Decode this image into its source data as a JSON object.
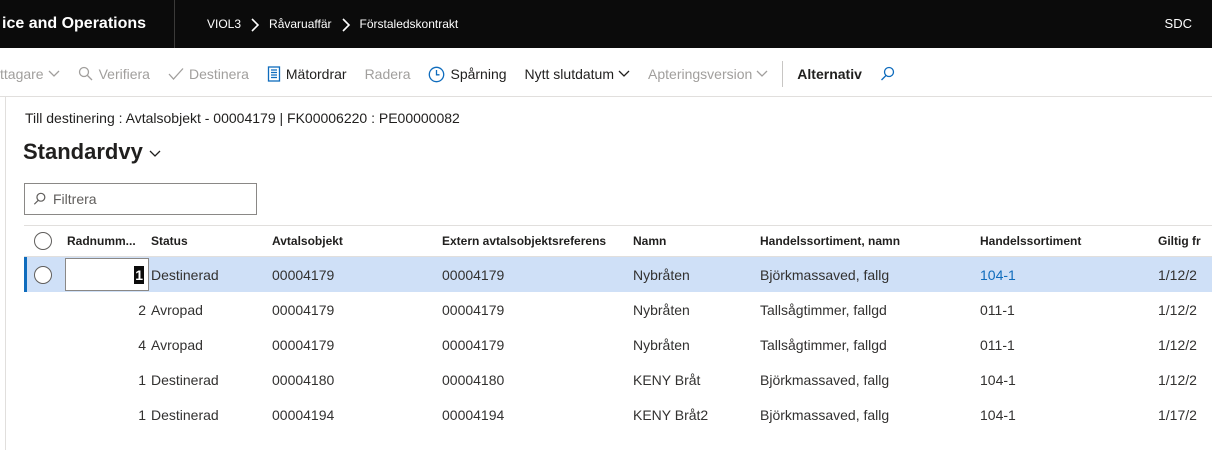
{
  "app": {
    "title": "ice and Operations",
    "company": "SDC"
  },
  "breadcrumb": [
    "VIOL3",
    "Råvaruaffär",
    "Förstaledskontrakt"
  ],
  "toolbar": {
    "items": [
      {
        "label": "ttagare",
        "disabled": true,
        "chevron": true,
        "icon": ""
      },
      {
        "label": "Verifiera",
        "disabled": true,
        "chevron": false,
        "icon": "search-icon"
      },
      {
        "label": "Destinera",
        "disabled": true,
        "chevron": false,
        "icon": "checkmark-icon"
      },
      {
        "label": "Mätordrar",
        "disabled": false,
        "chevron": false,
        "icon": "document-list-icon"
      },
      {
        "label": "Radera",
        "disabled": true,
        "chevron": false,
        "icon": ""
      },
      {
        "label": "Spårning",
        "disabled": false,
        "chevron": false,
        "icon": "clock-icon"
      },
      {
        "label": "Nytt slutdatum",
        "disabled": false,
        "chevron": true,
        "icon": ""
      },
      {
        "label": "Apteringsversion",
        "disabled": true,
        "chevron": true,
        "icon": ""
      }
    ],
    "options_label": "Alternativ"
  },
  "header": {
    "caption": "Till destinering : Avtalsobjekt - 00004179   |   FK00006220 : PE00000082",
    "view_name": "Standardvy"
  },
  "filter": {
    "placeholder": "Filtrera"
  },
  "grid": {
    "columns": {
      "row_number": "Radnumm...",
      "status": "Status",
      "avtalsobjekt": "Avtalsobjekt",
      "extern": "Extern avtalsobjektsreferens",
      "namn": "Namn",
      "handelssortiment_namn": "Handelssortiment, namn",
      "handelssortiment": "Handelssortiment",
      "giltig": "Giltig fr"
    },
    "rows": [
      {
        "row_number": "1",
        "status": "Destinerad",
        "avtalsobjekt": "00004179",
        "extern": "00004179",
        "namn": "Nybråten",
        "handelssortiment_namn": "Björkmassaved, fallg",
        "handelssortiment": "104-1",
        "giltig": "1/12/2"
      },
      {
        "row_number": "2",
        "status": "Avropad",
        "avtalsobjekt": "00004179",
        "extern": "00004179",
        "namn": "Nybråten",
        "handelssortiment_namn": "Tallsågtimmer, fallgd",
        "handelssortiment": "011-1",
        "giltig": "1/12/2"
      },
      {
        "row_number": "4",
        "status": "Avropad",
        "avtalsobjekt": "00004179",
        "extern": "00004179",
        "namn": "Nybråten",
        "handelssortiment_namn": "Tallsågtimmer, fallgd",
        "handelssortiment": "011-1",
        "giltig": "1/12/2"
      },
      {
        "row_number": "1",
        "status": "Destinerad",
        "avtalsobjekt": "00004180",
        "extern": "00004180",
        "namn": "KENY Bråt",
        "handelssortiment_namn": "Björkmassaved, fallg",
        "handelssortiment": "104-1",
        "giltig": "1/12/2"
      },
      {
        "row_number": "1",
        "status": "Destinerad",
        "avtalsobjekt": "00004194",
        "extern": "00004194",
        "namn": "KENY Bråt2",
        "handelssortiment_namn": "Björkmassaved, fallg",
        "handelssortiment": "104-1",
        "giltig": "1/17/2"
      }
    ]
  },
  "colors": {
    "navbar": "#0b0b0b",
    "selected_row": "#cfe0f7",
    "accent": "#0f6cbd",
    "disabled_text": "#a19f9d"
  }
}
